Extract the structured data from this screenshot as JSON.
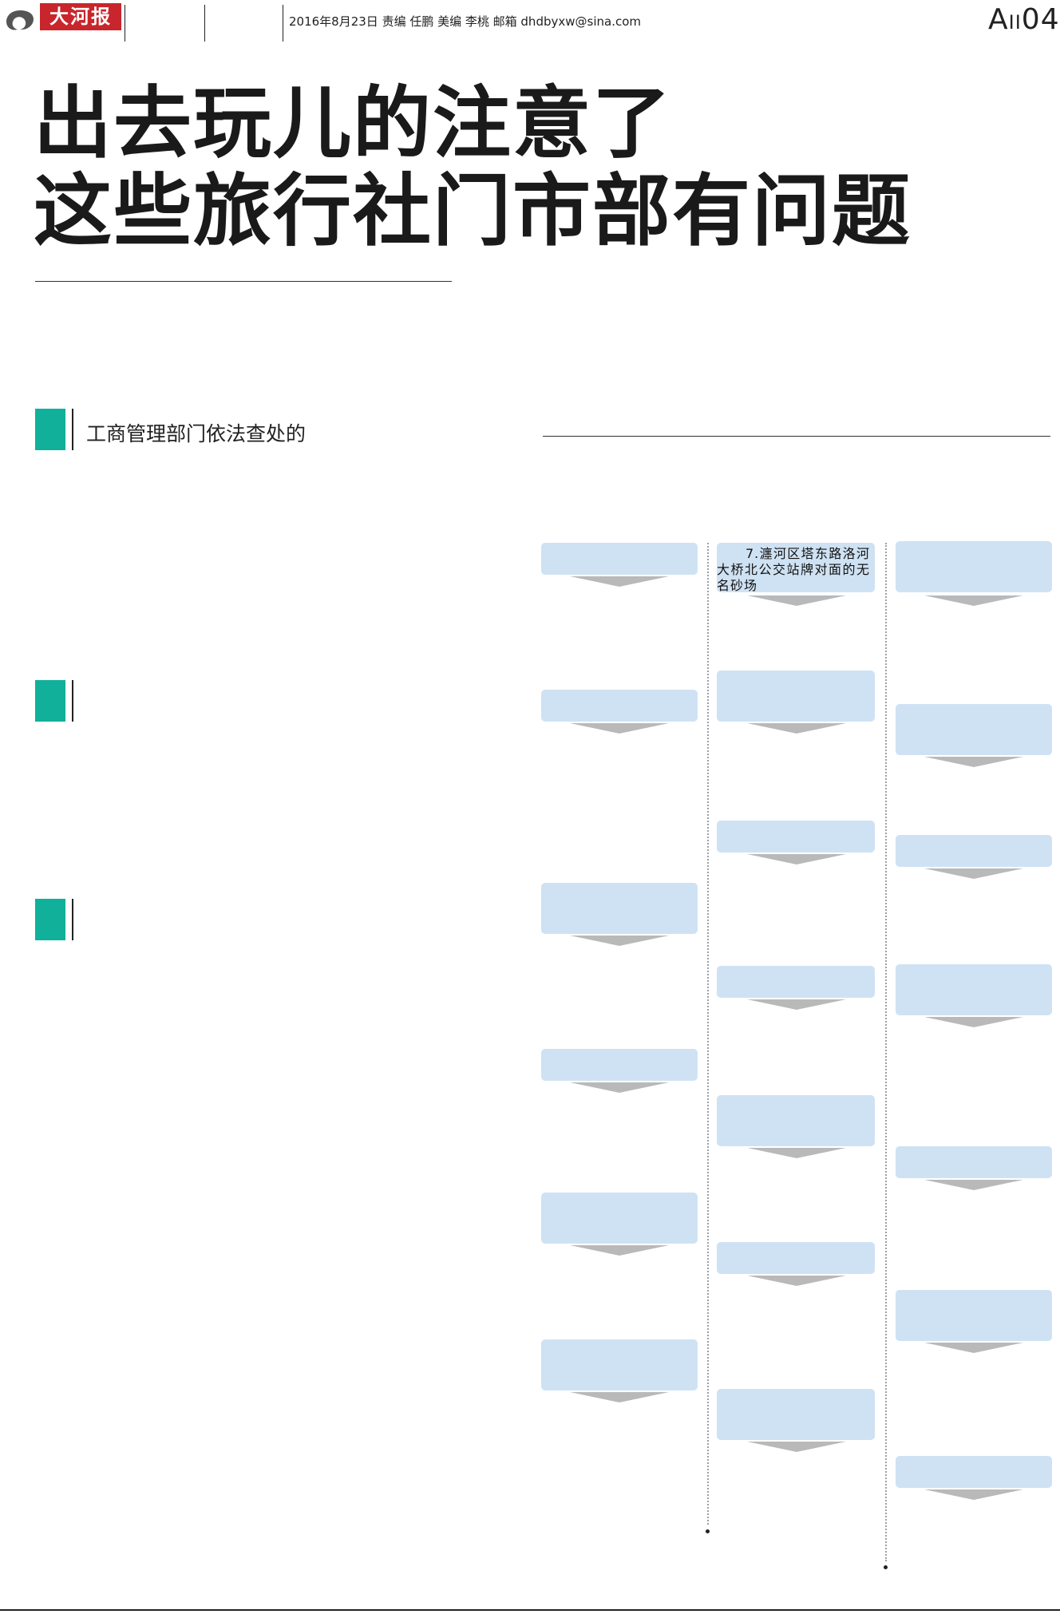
{
  "header": {
    "logo_text": "大河报",
    "info": "2016年8月23日 责编 任鹏 美编 李桃 邮箱 dhdbyxw@sina.com",
    "page_prefix": "A",
    "page_sub": "II",
    "page_number": "04"
  },
  "headline": {
    "line1": "出去玩儿的注意了",
    "line2": "这些旅行社门市部有问题"
  },
  "sections": [
    {
      "title": "工商管理部门依法查处的"
    },
    {
      "title": ""
    },
    {
      "title": ""
    }
  ],
  "boxes": {
    "col2_first": "7.瀍河区塔东路洛河大桥北公交站牌对面的无名砂场"
  },
  "colors": {
    "accent_teal": "#10b09a",
    "box_fill": "#cfe2f3",
    "arrow_gray": "#b9b9b9",
    "logo_red": "#c8262c"
  }
}
